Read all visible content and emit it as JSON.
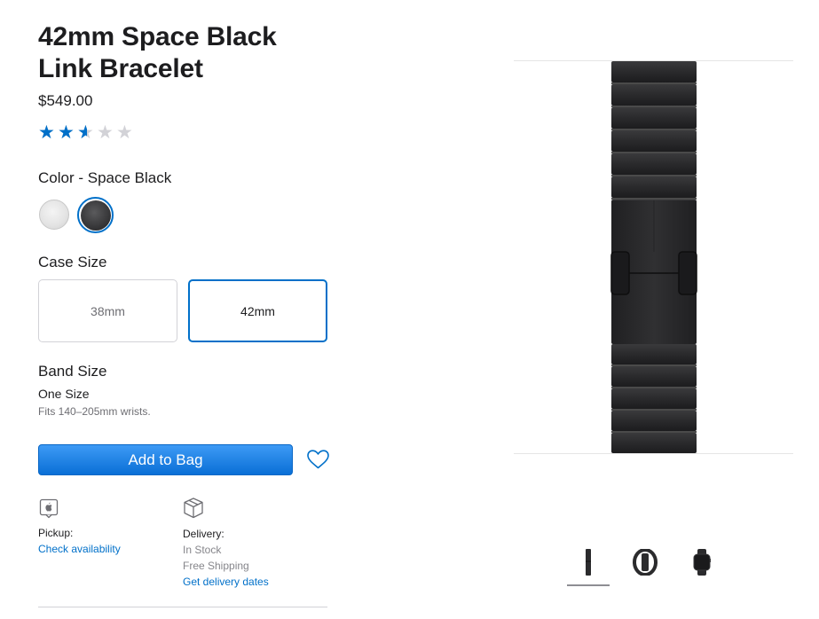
{
  "product": {
    "title_line1": "42mm Space Black",
    "title_line2": "Link Bracelet",
    "price": "$549.00",
    "rating": 2.5
  },
  "color": {
    "label": "Color - Space Black",
    "options": [
      "Silver",
      "Space Black"
    ],
    "selected": "Space Black"
  },
  "case_size": {
    "label": "Case Size",
    "options": [
      "38mm",
      "42mm"
    ],
    "selected": "42mm"
  },
  "band_size": {
    "label": "Band Size",
    "value": "One Size",
    "note": "Fits 140–205mm wrists."
  },
  "actions": {
    "add_to_bag": "Add to Bag"
  },
  "pickup": {
    "label": "Pickup:",
    "link": "Check availability"
  },
  "delivery": {
    "label": "Delivery:",
    "stock": "In Stock",
    "shipping": "Free Shipping",
    "link": "Get delivery dates"
  },
  "gallery": {
    "thumbnails": [
      "band-thumbnail",
      "watch-side-thumbnail",
      "watch-front-thumbnail"
    ],
    "selected_index": 0
  },
  "colors": {
    "accent": "#0070c9",
    "button": "#1a7fe3",
    "band": "#2b2b2d"
  }
}
